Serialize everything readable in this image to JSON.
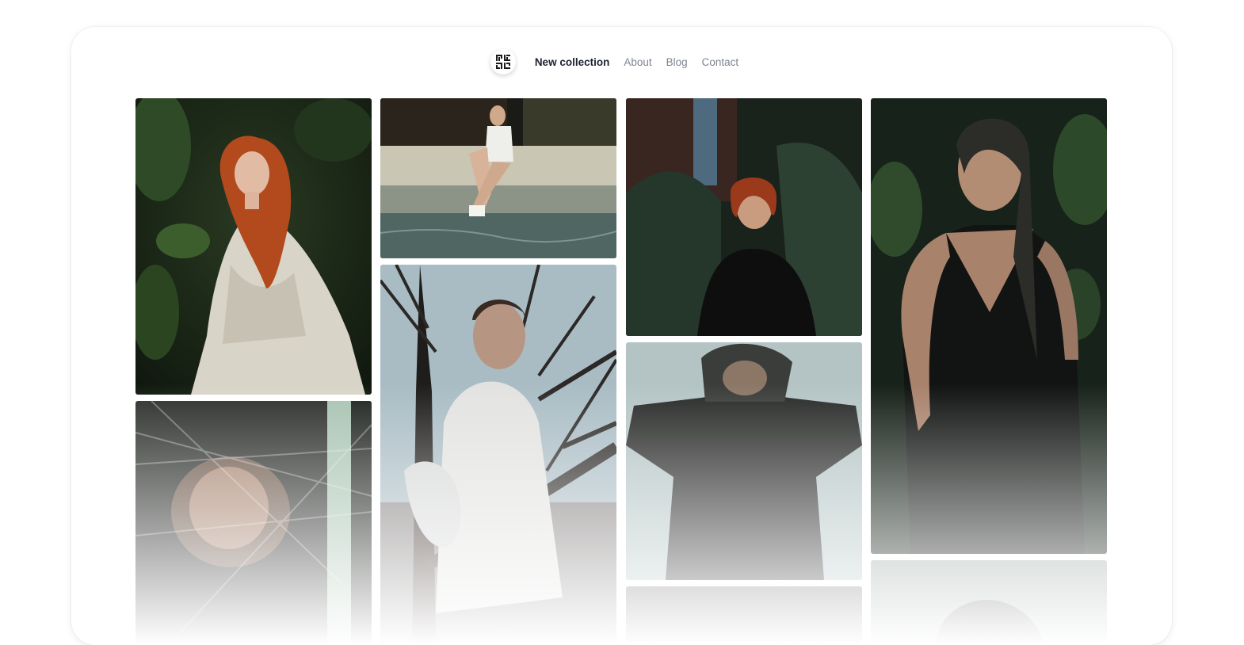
{
  "nav": {
    "logo_icon": "qr-pattern-logo-icon",
    "items": [
      {
        "label": "New collection",
        "active": true
      },
      {
        "label": "About",
        "active": false
      },
      {
        "label": "Blog",
        "active": false
      },
      {
        "label": "Contact",
        "active": false
      }
    ]
  },
  "gallery": {
    "photos": [
      {
        "name": "photo-redhead-white-dress-foliage"
      },
      {
        "name": "photo-seated-woman-pool"
      },
      {
        "name": "photo-bob-hair-black-dress-pines"
      },
      {
        "name": "photo-wet-hair-black-slip-dress"
      },
      {
        "name": "photo-face-under-plastic-wrap"
      },
      {
        "name": "photo-woman-white-plastic-coat-tree"
      },
      {
        "name": "photo-hooded-figure-raised-arms"
      },
      {
        "name": "photo-partial-column-3"
      },
      {
        "name": "photo-partial-veiled-figure"
      }
    ]
  }
}
